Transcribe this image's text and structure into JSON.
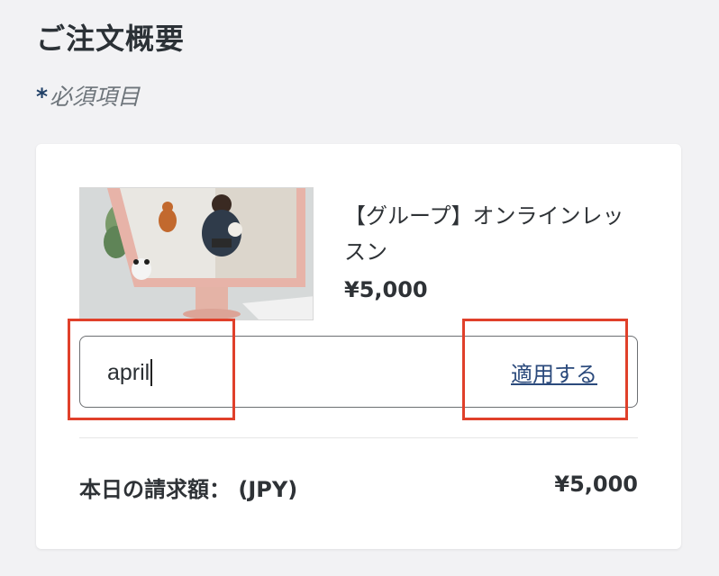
{
  "header": {
    "title": "ご注文概要",
    "required_star": "*",
    "required_label": "必須項目"
  },
  "product": {
    "name": "【グループ】オンラインレッスン",
    "price": "¥5,000",
    "image": "product-thumbnail"
  },
  "coupon": {
    "value": "april",
    "apply_label": "適用する"
  },
  "total": {
    "label": "本日の請求額： (JPY)",
    "value": "¥5,000"
  },
  "colors": {
    "highlight": "#e0402a",
    "link": "#2b4a7c"
  }
}
